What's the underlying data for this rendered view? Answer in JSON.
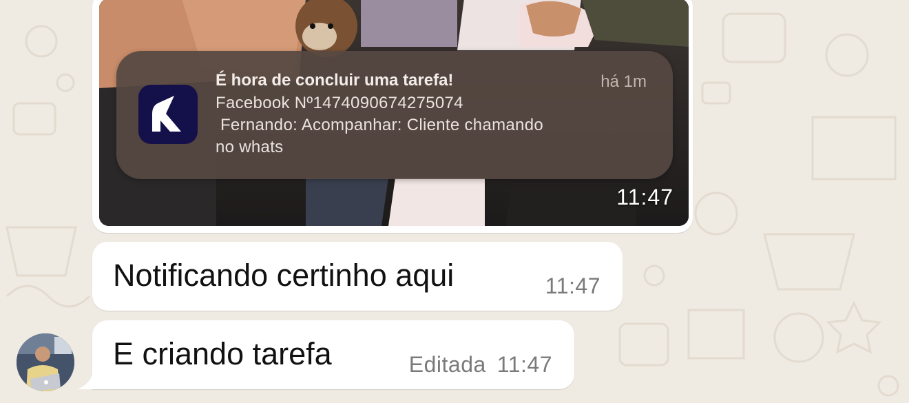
{
  "image_message": {
    "notification": {
      "app_icon": "k-logo-icon",
      "title": "É hora de concluir uma tarefa!",
      "time": "há 1m",
      "line1": "Facebook Nº1474090674275074",
      "line2": " Fernando: Acompanhar: Cliente chamando",
      "line3": "no whats"
    },
    "time": "11:47"
  },
  "messages": [
    {
      "text": "Notificando certinho aqui",
      "edited": "",
      "time": "11:47"
    },
    {
      "text": "E criando tarefa",
      "edited": "Editada",
      "time": "11:47"
    }
  ],
  "sender_avatar": "person-with-laptop-avatar",
  "colors": {
    "chat_background": "#efeae2",
    "bubble": "#ffffff",
    "notification_card": "#564842",
    "app_icon_bg": "#14114a",
    "meta_text": "#7a7a7a"
  }
}
